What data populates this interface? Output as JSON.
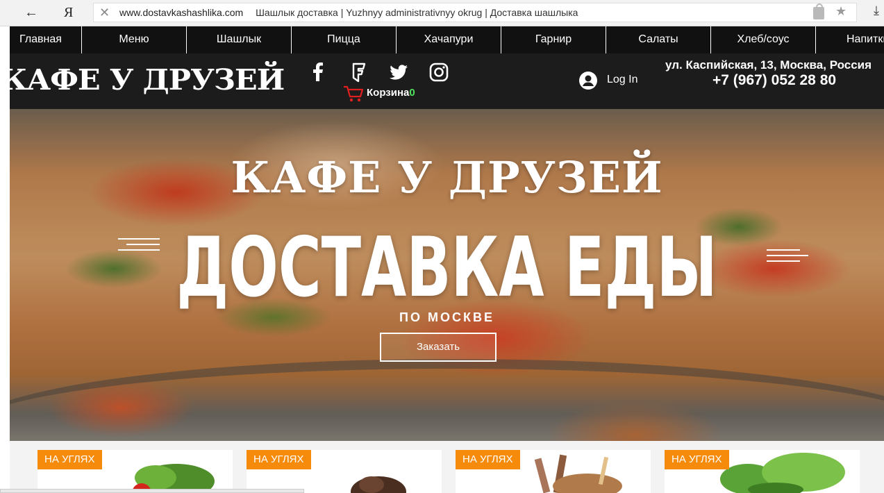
{
  "browser": {
    "back_label": "←",
    "yandex_label": "Я",
    "close_label": "✕",
    "url": "www.dostavkashashlika.com",
    "title": "Шашлык доставка | Yuzhnyy administrativnyy okrug | Доставка шашлыка",
    "star_label": "★",
    "download_label": "⤓"
  },
  "nav": {
    "items": [
      {
        "label": "Главная"
      },
      {
        "label": "Меню"
      },
      {
        "label": "Шашлык"
      },
      {
        "label": "Пицца"
      },
      {
        "label": "Хачапури"
      },
      {
        "label": "Гарнир"
      },
      {
        "label": "Салаты"
      },
      {
        "label": "Хлеб/соус"
      },
      {
        "label": "Напитки"
      }
    ]
  },
  "header": {
    "logo": "КАФЕ У ДРУЗЕЙ",
    "social": [
      "facebook-icon",
      "foursquare-icon",
      "twitter-icon",
      "instagram-icon"
    ],
    "cart": {
      "label": "Корзина",
      "count": "0"
    },
    "login_label": "Log In",
    "address": "ул. Каспийская, 13, Москва, Россия",
    "phone": "+7 (967) 052 28 80"
  },
  "hero": {
    "title": "КАФЕ У ДРУЗЕЙ",
    "subtitle": "ДОСТАВКА ЕДЫ",
    "city": "ПО МОСКВЕ",
    "order_button": "Заказать"
  },
  "cards": [
    {
      "badge": "НА УГЛЯХ"
    },
    {
      "badge": "НА УГЛЯХ"
    },
    {
      "badge": "НА УГЛЯХ"
    },
    {
      "badge": "НА УГЛЯХ"
    }
  ],
  "colors": {
    "nav_bg": "#111111",
    "header_bg": "#1c1c1c",
    "badge": "#f58a0b",
    "cart_icon": "#e02020",
    "cart_count": "#4fe05a"
  }
}
